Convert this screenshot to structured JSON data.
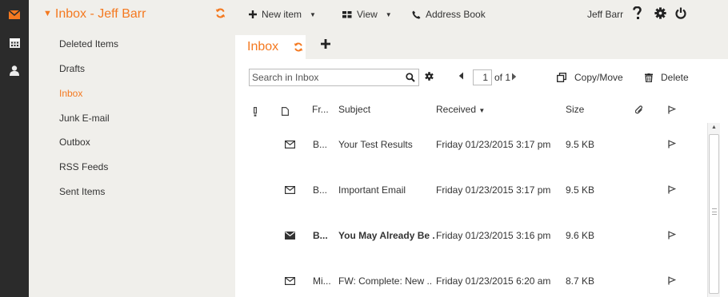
{
  "folders": {
    "title": "Inbox - Jeff Barr",
    "items": [
      {
        "label": "Deleted Items",
        "active": false
      },
      {
        "label": "Drafts",
        "active": false
      },
      {
        "label": "Inbox",
        "active": true
      },
      {
        "label": "Junk E-mail",
        "active": false
      },
      {
        "label": "Outbox",
        "active": false
      },
      {
        "label": "RSS Feeds",
        "active": false
      },
      {
        "label": "Sent Items",
        "active": false
      }
    ]
  },
  "topbar": {
    "new_item": "New item",
    "view": "View",
    "address_book": "Address Book",
    "user": "Jeff Barr"
  },
  "tabs": {
    "active": "Inbox"
  },
  "toolbar": {
    "search_placeholder": "Search in Inbox",
    "page": "1",
    "page_of": "of 1",
    "copy_move": "Copy/Move",
    "delete": "Delete"
  },
  "columns": {
    "from": "Fr...",
    "subject": "Subject",
    "received": "Received",
    "size": "Size"
  },
  "messages": [
    {
      "from": "B...",
      "subject": "Your Test Results",
      "received": "Friday 01/23/2015 3:17 pm",
      "size": "9.5 KB",
      "unread": false
    },
    {
      "from": "B...",
      "subject": "Important Email",
      "received": "Friday 01/23/2015 3:17 pm",
      "size": "9.5 KB",
      "unread": false
    },
    {
      "from": "B...",
      "subject": "You May Already Be ...",
      "received": "Friday 01/23/2015 3:16 pm",
      "size": "9.6 KB",
      "unread": true
    },
    {
      "from": "Mi...",
      "subject": "FW: Complete: New ...",
      "received": "Friday 01/23/2015 6:20 am",
      "size": "8.7 KB",
      "unread": false
    }
  ],
  "colors": {
    "accent": "#f47920",
    "rail": "#2b2b2b",
    "pane": "#f0efeb"
  },
  "icons": [
    "mail-icon",
    "calendar-icon",
    "contacts-icon",
    "refresh-icon",
    "plus-icon",
    "view-grid-icon",
    "phone-icon",
    "help-icon",
    "gear-icon",
    "power-icon",
    "search-icon",
    "copy-icon",
    "trash-icon",
    "envelope-icon",
    "flag-icon",
    "attachment-icon",
    "document-icon",
    "importance-icon"
  ]
}
